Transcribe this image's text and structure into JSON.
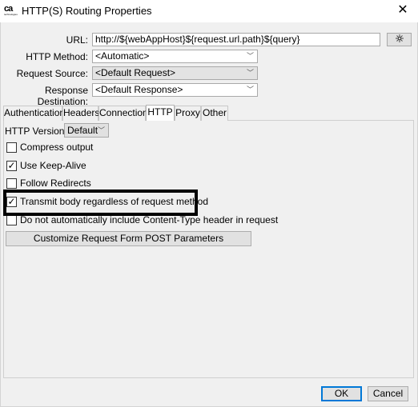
{
  "window": {
    "title": "HTTP(S) Routing Properties",
    "logo_text": "ca",
    "logo_subtext": "technologies",
    "close_glyph": "✕"
  },
  "form": {
    "url_label": "URL:",
    "url_value": "http://${webAppHost}${request.url.path}${query}",
    "http_method_label": "HTTP Method:",
    "http_method_value": "<Automatic>",
    "request_source_label": "Request Source:",
    "request_source_value": "<Default Request>",
    "response_destination_label": "Response Destination:",
    "response_destination_value": "<Default Response>"
  },
  "tabs": [
    {
      "label": "Authentication"
    },
    {
      "label": "Headers"
    },
    {
      "label": "Connection"
    },
    {
      "label": "HTTP"
    },
    {
      "label": "Proxy"
    },
    {
      "label": "Other"
    }
  ],
  "active_tab": "HTTP",
  "http_tab": {
    "version_label": "HTTP Version:",
    "version_value": "Default",
    "options": [
      {
        "label": "Compress output",
        "checked": false
      },
      {
        "label": "Use Keep-Alive",
        "checked": true
      },
      {
        "label": "Follow Redirects",
        "checked": false
      },
      {
        "label": "Transmit body regardless of request method",
        "checked": true
      },
      {
        "label": "Do not automatically include Content-Type header in request",
        "checked": false
      }
    ],
    "customize_button": "Customize Request Form POST Parameters"
  },
  "footer": {
    "ok": "OK",
    "cancel": "Cancel"
  },
  "icons": {
    "dropdown": "chevron-down-icon",
    "wand": "wand-icon",
    "check": "check-icon"
  },
  "colors": {
    "dialog_bg": "#f0f0f0",
    "default_button_border": "#0078d7",
    "highlight_border": "#000000"
  }
}
